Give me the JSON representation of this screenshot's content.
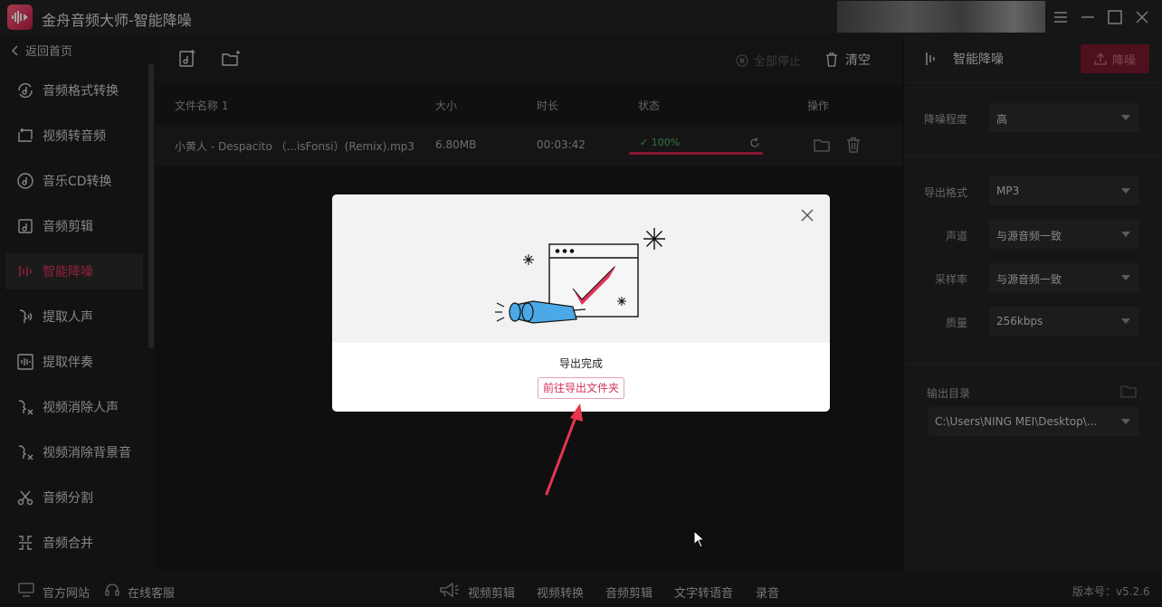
{
  "app": {
    "title": "金舟音频大师-智能降噪"
  },
  "sidebar": {
    "back_label": "返回首页",
    "items": [
      {
        "label": "音频格式转换",
        "icon": "music-convert-icon"
      },
      {
        "label": "视频转音频",
        "icon": "video-to-audio-icon"
      },
      {
        "label": "音乐CD转换",
        "icon": "cd-icon"
      },
      {
        "label": "音频剪辑",
        "icon": "audio-cut-icon"
      },
      {
        "label": "智能降噪",
        "icon": "denoise-icon",
        "active": true
      },
      {
        "label": "提取人声",
        "icon": "vocal-icon"
      },
      {
        "label": "提取伴奏",
        "icon": "accompaniment-icon"
      },
      {
        "label": "视频消除人声",
        "icon": "video-vocal-remove-icon"
      },
      {
        "label": "视频消除背景音",
        "icon": "video-bg-remove-icon"
      },
      {
        "label": "音频分割",
        "icon": "scissors-icon"
      },
      {
        "label": "音频合并",
        "icon": "merge-icon"
      }
    ]
  },
  "toolbar": {
    "stop_all": "全部停止",
    "clear": "清空"
  },
  "table": {
    "headers": {
      "name": "文件名称 1",
      "size": "大小",
      "duration": "时长",
      "status": "状态",
      "actions": "操作"
    },
    "rows": [
      {
        "name": "小黄人 - Despacito （...isFonsi）(Remix).mp3",
        "size": "6.80MB",
        "duration": "00:03:42",
        "progress": "100%",
        "progress_value": 1.0
      }
    ]
  },
  "right_panel": {
    "title": "智能降噪",
    "denoise_button": "降噪",
    "level_label": "降噪程度",
    "level_value": "高",
    "format_label": "导出格式",
    "format_value": "MP3",
    "channel_label": "声道",
    "channel_value": "与源音频一致",
    "samplerate_label": "采样率",
    "samplerate_value": "与源音频一致",
    "quality_label": "质量",
    "quality_value": "256kbps",
    "output_label": "输出目录",
    "output_value": "C:\\Users\\NING MEI\\Desktop\\..."
  },
  "bottom": {
    "website": "官方网站",
    "service": "在线客服",
    "links": [
      "视频剪辑",
      "视频转换",
      "音频剪辑",
      "文字转语音",
      "录音"
    ],
    "version": "版本号：v5.2.6"
  },
  "modal": {
    "message": "导出完成",
    "link": "前往导出文件夹"
  },
  "colors": {
    "accent": "#d1325c",
    "success": "#4ab866"
  }
}
